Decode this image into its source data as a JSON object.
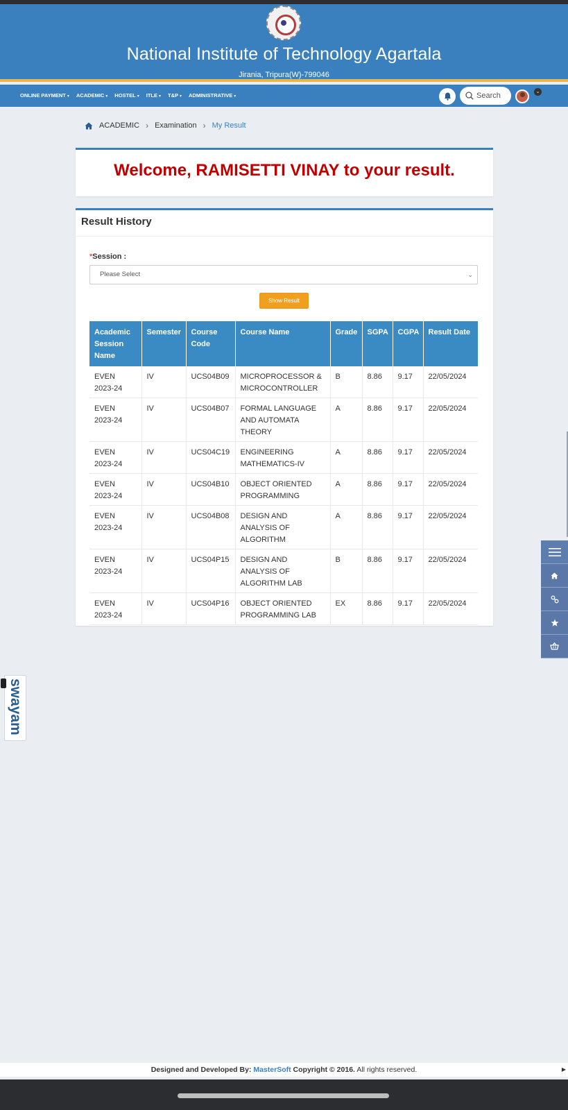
{
  "header": {
    "institute_name": "National Institute of Technology Agartala",
    "address": "Jirania, Tripura(W)-799046"
  },
  "nav": {
    "items": [
      {
        "label": "ONLINE PAYMENT",
        "icon": "caret-down-icon"
      },
      {
        "label": "ACADEMIC",
        "icon": "caret-down-icon"
      },
      {
        "label": "HOSTEL",
        "icon": "caret-down-icon"
      },
      {
        "label": "ITLE",
        "icon": "caret-down-icon"
      },
      {
        "label": "T&P",
        "icon": "caret-down-icon"
      },
      {
        "label": "ADMINISTRATIVE",
        "icon": "caret-down-icon"
      }
    ],
    "search_label": "Search"
  },
  "breadcrumb": {
    "items": [
      "ACADEMIC",
      "Examination",
      "My Result"
    ]
  },
  "welcome": {
    "text": "Welcome, RAMISETTI VINAY to your result."
  },
  "result": {
    "title": "Result History",
    "session_label": "Session :",
    "required_mark": "*",
    "select_placeholder": "Please Select",
    "show_button": "Show Result",
    "columns": [
      "Academic Session Name",
      "Semester",
      "Course Code",
      "Course Name",
      "Grade",
      "SGPA",
      "CGPA",
      "Result Date"
    ],
    "rows": [
      [
        "EVEN 2023-24",
        "IV",
        "UCS04B09",
        "MICROPROCESSOR & MICROCONTROLLER",
        "B",
        "8.86",
        "9.17",
        "22/05/2024"
      ],
      [
        "EVEN 2023-24",
        "IV",
        "UCS04B07",
        "FORMAL LANGUAGE AND AUTOMATA THEORY",
        "A",
        "8.86",
        "9.17",
        "22/05/2024"
      ],
      [
        "EVEN 2023-24",
        "IV",
        "UCS04C19",
        "ENGINEERING MATHEMATICS-IV",
        "A",
        "8.86",
        "9.17",
        "22/05/2024"
      ],
      [
        "EVEN 2023-24",
        "IV",
        "UCS04B10",
        "OBJECT ORIENTED PROGRAMMING",
        "A",
        "8.86",
        "9.17",
        "22/05/2024"
      ],
      [
        "EVEN 2023-24",
        "IV",
        "UCS04B08",
        "DESIGN AND ANALYSIS OF ALGORITHM",
        "A",
        "8.86",
        "9.17",
        "22/05/2024"
      ],
      [
        "EVEN 2023-24",
        "IV",
        "UCS04P15",
        "DESIGN AND ANALYSIS OF ALGORITHM LAB",
        "B",
        "8.86",
        "9.17",
        "22/05/2024"
      ],
      [
        "EVEN 2023-24",
        "IV",
        "UCS04P16",
        "OBJECT ORIENTED PROGRAMMING LAB",
        "EX",
        "8.86",
        "9.17",
        "22/05/2024"
      ]
    ]
  },
  "side_tools": [
    "menu-icon",
    "home-icon",
    "link-icon",
    "star-icon",
    "basket-icon"
  ],
  "swayam": {
    "label": "swayam"
  },
  "footer": {
    "designed_by": "Designed and Developed By:",
    "company": "MasterSoft",
    "copyright": "Copyright © 2016.",
    "rights": "All rights reserved."
  }
}
